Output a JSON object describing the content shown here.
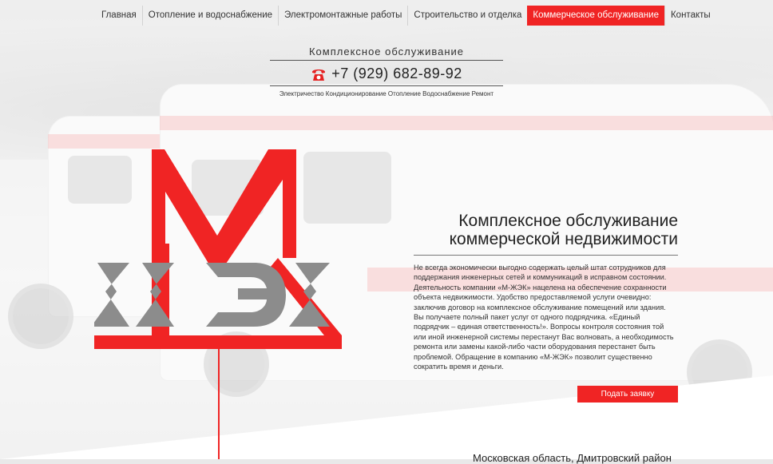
{
  "nav": {
    "items": [
      {
        "label": "Главная",
        "active": false
      },
      {
        "label": "Отопление и водоснабжение",
        "active": false
      },
      {
        "label": "Электромонтажные работы",
        "active": false
      },
      {
        "label": "Строительство и отделка",
        "active": false
      },
      {
        "label": "Коммерческое обслуживание",
        "active": true
      },
      {
        "label": "Контакты",
        "active": false
      }
    ]
  },
  "header": {
    "subtitle": "Комплексное обслуживание",
    "phone": "+7 (929) 682-89-92",
    "phone_icon": "phone-icon",
    "services": "Электричество Кондиционирование Отопление Водоснабжение Ремонт"
  },
  "main": {
    "title_line1": "Комплексное обслуживание",
    "title_line2": "коммерческой недвижимости",
    "description": "Не всегда экономически выгодно содержать целый штат сотрудников для поддержания инженерных сетей и коммуникаций в исправном состоянии. Деятельность компании «М-ЖЭК» нацелена на обеспечение сохранности объекта недвижимости. Удобство предоставляемой услуги очевидно: заключив договор на комплексное обслуживание помещений или здания. Вы получаете полный пакет услуг от одного подрядчика. «Единый подрядчик – единая ответственность!». Вопросы контроля состояния той или иной инженерной системы перестанут Вас волновать, а необходимость ремонта или замены какой-либо части оборудования перестанет быть проблемой. Обращение в компанию «М-ЖЭК» позволит существенно сократить время и деньги.",
    "cta_label": "Подать заявку"
  },
  "footer": {
    "address": "Московская область, Дмитровский район"
  },
  "colors": {
    "accent": "#f02424",
    "logo_gray": "#8c8c8c"
  }
}
